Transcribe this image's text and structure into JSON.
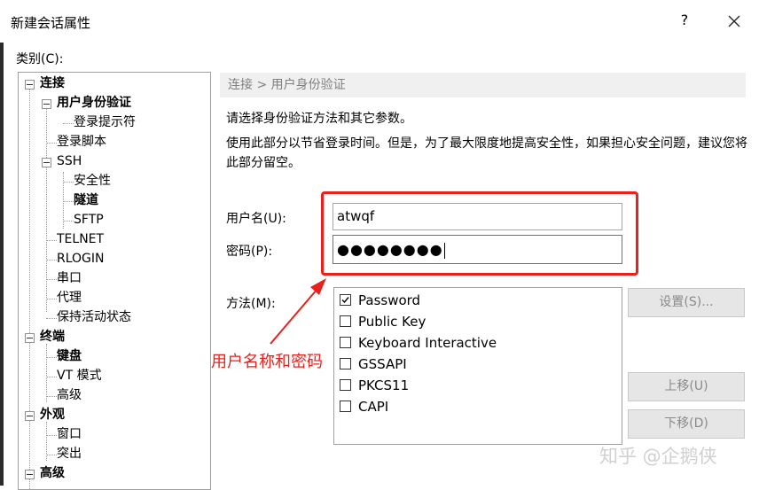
{
  "window": {
    "title": "新建会话属性",
    "help_label": "?"
  },
  "category_label": "类别(C):",
  "tree": [
    {
      "label": "连接",
      "bold": true
    },
    {
      "label": "用户身份验证",
      "bold": true
    },
    {
      "label": "登录提示符",
      "bold": false
    },
    {
      "label": "登录脚本",
      "bold": false
    },
    {
      "label": "SSH",
      "bold": false
    },
    {
      "label": "安全性",
      "bold": false
    },
    {
      "label": "隧道",
      "bold": true
    },
    {
      "label": "SFTP",
      "bold": false
    },
    {
      "label": "TELNET",
      "bold": false
    },
    {
      "label": "RLOGIN",
      "bold": false
    },
    {
      "label": "串口",
      "bold": false
    },
    {
      "label": "代理",
      "bold": false
    },
    {
      "label": "保持活动状态",
      "bold": false
    },
    {
      "label": "终端",
      "bold": true
    },
    {
      "label": "键盘",
      "bold": true
    },
    {
      "label": "VT 模式",
      "bold": false
    },
    {
      "label": "高级",
      "bold": false
    },
    {
      "label": "外观",
      "bold": true
    },
    {
      "label": "窗口",
      "bold": false
    },
    {
      "label": "突出",
      "bold": false
    },
    {
      "label": "高级",
      "bold": false
    }
  ],
  "breadcrumb": "连接 > 用户身份验证",
  "description": {
    "line1": "请选择身份验证方法和其它参数。",
    "line2": "使用此部分以节省登录时间。但是，为了最大限度地提高安全性，如果担心安全问题，建议您将此部分留空。"
  },
  "form": {
    "username_label": "用户名(U):",
    "username_value": "atwqf",
    "password_label": "密码(P):",
    "password_value": "●●●●●●●●"
  },
  "method": {
    "label": "方法(M):",
    "items": [
      {
        "label": "Password",
        "checked": true
      },
      {
        "label": "Public Key",
        "checked": false
      },
      {
        "label": "Keyboard Interactive",
        "checked": false
      },
      {
        "label": "GSSAPI",
        "checked": false
      },
      {
        "label": "PKCS11",
        "checked": false
      },
      {
        "label": "CAPI",
        "checked": false
      }
    ]
  },
  "buttons": {
    "settings": "设置(S)...",
    "move_up": "上移(U)",
    "move_down": "下移(D)"
  },
  "annotation": "用户名称和密码",
  "watermark": "知乎 @企鹅侠",
  "colors": {
    "annotation_red": "#e8211d",
    "focus_border": "#3c7fc1"
  }
}
